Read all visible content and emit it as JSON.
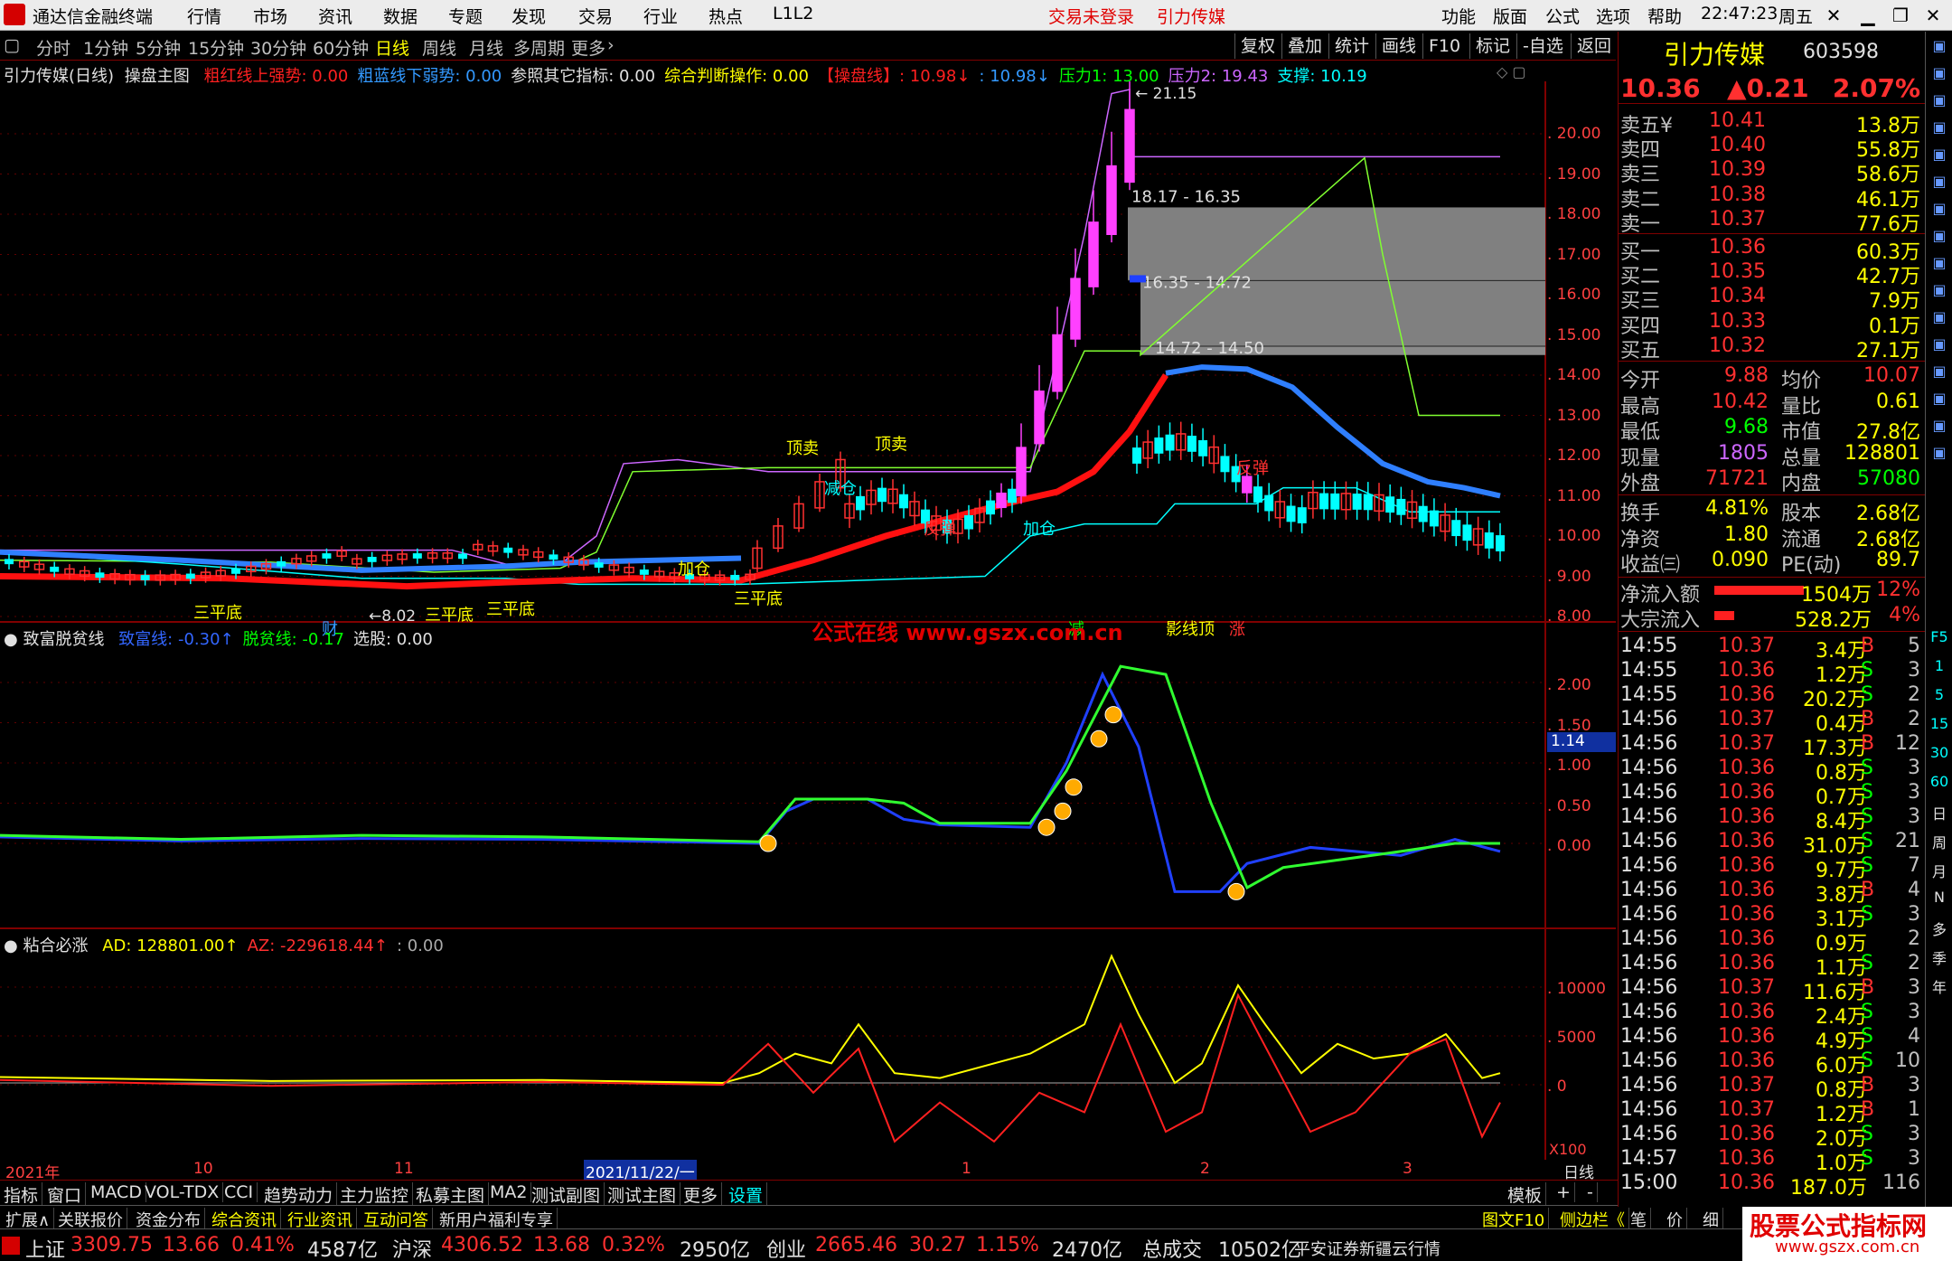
{
  "menubar": {
    "app_title": "通达信金融终端",
    "menus": [
      "行情",
      "市场",
      "资讯",
      "数据",
      "专题",
      "发现",
      "交易",
      "行业",
      "热点",
      "L1L2"
    ],
    "status_red": [
      "交易未登录",
      "引力传媒"
    ],
    "right_menus": [
      "功能",
      "版面",
      "公式",
      "选项",
      "帮助"
    ],
    "time": "22:47:23",
    "weekday": "周五"
  },
  "periods": [
    "分时",
    "1分钟",
    "5分钟",
    "15分钟",
    "30分钟",
    "60分钟",
    "日线",
    "周线",
    "月线",
    "多周期",
    "更多"
  ],
  "period_active": "日线",
  "toolbar_right": [
    "复权",
    "叠加",
    "统计",
    "画线",
    "F10",
    "标记",
    "-自选",
    "返回"
  ],
  "main_panel": {
    "title": "引力传媒(日线)",
    "indicator": "操盘主图",
    "legend": [
      {
        "text": "粗红线上强势: 0.00",
        "color": "#ff2020"
      },
      {
        "text": "粗蓝线下弱势: 0.00",
        "color": "#3399ff"
      },
      {
        "text": "参照其它指标: 0.00",
        "color": "#e0e0e0"
      },
      {
        "text": "综合判断操作: 0.00",
        "color": "#ffff00"
      },
      {
        "text": "【操盘线】: 10.98↓",
        "color": "#ff2020"
      },
      {
        "text": ": 10.98↓",
        "color": "#3399ff"
      },
      {
        "text": "压力1: 13.00",
        "color": "#00ff00"
      },
      {
        "text": "压力2: 19.43",
        "color": "#cc66ff"
      },
      {
        "text": "支撑: 10.19",
        "color": "#00ffff"
      }
    ],
    "y_ticks": [
      "20.00",
      "19.00",
      "18.00",
      "17.00",
      "16.00",
      "15.00",
      "14.00",
      "13.00",
      "12.00",
      "11.00",
      "10.00",
      "9.00",
      "8.00"
    ],
    "annotations": {
      "high": "21.15",
      "low": "8.02",
      "zones": [
        "18.17 - 16.35",
        "16.35 - 14.72",
        "14.72 - 14.50"
      ],
      "signals": [
        "顶卖",
        "顶卖",
        "减仓",
        "反弹",
        "加仓",
        "加仓",
        "三平底",
        "三平底",
        "三平底",
        "三平底",
        "反弹",
        "财",
        "减",
        "影线顶",
        "涨"
      ]
    }
  },
  "watermark": "公式在线 www.gszx.com.cn",
  "panel2": {
    "name": "致富脱贫线",
    "legend": [
      {
        "text": "致富线: -0.30↑",
        "color": "#3366ff"
      },
      {
        "text": "脱贫线: -0.17",
        "color": "#00ff00"
      },
      {
        "text": "选股: 0.00",
        "color": "#e0e0e0"
      }
    ],
    "y_ticks": [
      "2.00",
      "1.50",
      "1.00",
      "0.50",
      "0.00"
    ],
    "cursor_value": "1.14"
  },
  "panel3": {
    "name": "粘合必涨",
    "legend": [
      {
        "text": "AD: 128801.00↑",
        "color": "#ffff00"
      },
      {
        "text": "AZ: -229618.44↑",
        "color": "#ff3030"
      },
      {
        "text": ": 0.00",
        "color": "#aaaaaa"
      }
    ],
    "y_ticks": [
      "10000",
      "5000",
      "0"
    ],
    "scale": "X100"
  },
  "date_axis": [
    "2021年",
    "10",
    "11",
    "2021/11/22/一",
    "1",
    "2",
    "3",
    "日线"
  ],
  "bottom_tabs": [
    "指标",
    "窗口",
    "MACD",
    "VOL-TDX",
    "CCI",
    "趋势动力",
    "主力监控",
    "私募主图",
    "MA2",
    "测试副图",
    "测试主图",
    "更多",
    "设置",
    "模板",
    "+",
    "-"
  ],
  "info_tabs": [
    "扩展∧",
    "关联报价",
    "资金分布",
    "综合资讯",
    "行业资讯",
    "互动问答",
    "新用户福利专享",
    "图文F10",
    "侧边栏《",
    "笔",
    "价",
    "细"
  ],
  "quote": {
    "name": "引力传媒",
    "code": "603598",
    "price": "10.36",
    "change": "▲0.21",
    "pct": "2.07%",
    "asks": [
      {
        "label": "卖五¥",
        "price": "10.41",
        "vol": "13.8万"
      },
      {
        "label": "卖四",
        "price": "10.40",
        "vol": "55.8万"
      },
      {
        "label": "卖三",
        "price": "10.39",
        "vol": "58.6万"
      },
      {
        "label": "卖二",
        "price": "10.38",
        "vol": "46.1万"
      },
      {
        "label": "卖一",
        "price": "10.37",
        "vol": "77.6万"
      }
    ],
    "bids": [
      {
        "label": "买一",
        "price": "10.36",
        "vol": "60.3万"
      },
      {
        "label": "买二",
        "price": "10.35",
        "vol": "42.7万"
      },
      {
        "label": "买三",
        "price": "10.34",
        "vol": "7.9万"
      },
      {
        "label": "买四",
        "price": "10.33",
        "vol": "0.1万"
      },
      {
        "label": "买五",
        "price": "10.32",
        "vol": "27.1万"
      }
    ],
    "stats": [
      {
        "l1": "今开",
        "v1": "9.88",
        "l2": "均价",
        "v2": "10.07"
      },
      {
        "l1": "最高",
        "v1": "10.42",
        "l2": "量比",
        "v2": "0.61"
      },
      {
        "l1": "最低",
        "v1": "9.68",
        "l2": "市值",
        "v2": "27.8亿"
      },
      {
        "l1": "现量",
        "v1": "1805",
        "l2": "总量",
        "v2": "128801"
      },
      {
        "l1": "外盘",
        "v1": "71721",
        "l2": "内盘",
        "v2": "57080"
      },
      {
        "l1": "换手",
        "v1": "4.81%",
        "l2": "股本",
        "v2": "2.68亿"
      },
      {
        "l1": "净资",
        "v1": "1.80",
        "l2": "流通",
        "v2": "2.68亿"
      },
      {
        "l1": "收益㈢",
        "v1": "0.090",
        "l2": "PE(动)",
        "v2": "89.7"
      }
    ],
    "flows": [
      {
        "label": "净流入额",
        "value": "1504万",
        "pct": "12%",
        "bar": 0.9
      },
      {
        "label": "大宗流入",
        "value": "528.2万",
        "pct": "4%",
        "bar": 0.2
      }
    ]
  },
  "ticks": [
    {
      "t": "14:55",
      "p": "10.37",
      "v": "3.4万",
      "bs": "B",
      "n": "5"
    },
    {
      "t": "14:55",
      "p": "10.36",
      "v": "1.2万",
      "bs": "S",
      "n": "3"
    },
    {
      "t": "14:55",
      "p": "10.36",
      "v": "20.2万",
      "bs": "S",
      "n": "2"
    },
    {
      "t": "14:56",
      "p": "10.37",
      "v": "0.4万",
      "bs": "B",
      "n": "2"
    },
    {
      "t": "14:56",
      "p": "10.37",
      "v": "17.3万",
      "bs": "B",
      "n": "12"
    },
    {
      "t": "14:56",
      "p": "10.36",
      "v": "0.8万",
      "bs": "S",
      "n": "3"
    },
    {
      "t": "14:56",
      "p": "10.36",
      "v": "0.7万",
      "bs": "S",
      "n": "3"
    },
    {
      "t": "14:56",
      "p": "10.36",
      "v": "8.4万",
      "bs": "S",
      "n": "3"
    },
    {
      "t": "14:56",
      "p": "10.36",
      "v": "31.0万",
      "bs": "S",
      "n": "21"
    },
    {
      "t": "14:56",
      "p": "10.36",
      "v": "9.7万",
      "bs": "S",
      "n": "7"
    },
    {
      "t": "14:56",
      "p": "10.36",
      "v": "3.8万",
      "bs": "B",
      "n": "4"
    },
    {
      "t": "14:56",
      "p": "10.36",
      "v": "3.1万",
      "bs": "S",
      "n": "3"
    },
    {
      "t": "14:56",
      "p": "10.36",
      "v": "0.9万",
      "bs": "",
      "n": "2"
    },
    {
      "t": "14:56",
      "p": "10.36",
      "v": "1.1万",
      "bs": "S",
      "n": "2"
    },
    {
      "t": "14:56",
      "p": "10.37",
      "v": "11.6万",
      "bs": "B",
      "n": "3"
    },
    {
      "t": "14:56",
      "p": "10.36",
      "v": "2.4万",
      "bs": "S",
      "n": "3"
    },
    {
      "t": "14:56",
      "p": "10.36",
      "v": "4.9万",
      "bs": "S",
      "n": "4"
    },
    {
      "t": "14:56",
      "p": "10.36",
      "v": "6.0万",
      "bs": "S",
      "n": "10"
    },
    {
      "t": "14:56",
      "p": "10.37",
      "v": "0.8万",
      "bs": "B",
      "n": "3"
    },
    {
      "t": "14:56",
      "p": "10.37",
      "v": "1.2万",
      "bs": "B",
      "n": "1"
    },
    {
      "t": "14:56",
      "p": "10.36",
      "v": "2.0万",
      "bs": "S",
      "n": "3"
    },
    {
      "t": "14:57",
      "p": "10.36",
      "v": "1.0万",
      "bs": "S",
      "n": "3"
    },
    {
      "t": "15:00",
      "p": "10.36",
      "v": "187.0万",
      "bs": "",
      "n": "116"
    }
  ],
  "sidebar": [
    "F5",
    "1",
    "5",
    "15",
    "30",
    "60",
    "日",
    "周",
    "月",
    "N",
    "多",
    "季",
    "年"
  ],
  "status": {
    "items": [
      {
        "name": "上证",
        "v": "3309.75",
        "c": "13.66",
        "p": "0.41%",
        "a": "4587亿"
      },
      {
        "name": "沪深",
        "v": "4306.52",
        "c": "13.68",
        "p": "0.32%",
        "a": "2950亿"
      },
      {
        "name": "创业",
        "v": "2665.46",
        "c": "30.27",
        "p": "1.15%",
        "a": "2470亿"
      }
    ],
    "total_label": "总成交",
    "total": "10502亿",
    "broker": "平安证券新疆云行情"
  },
  "brand_logo": {
    "line1": "股票公式指标网",
    "line2": "www.gszx.com.cn"
  },
  "colors": {
    "up": "#ff3030",
    "down": "#00ffff",
    "bg": "#000000",
    "grid": "#800000"
  }
}
